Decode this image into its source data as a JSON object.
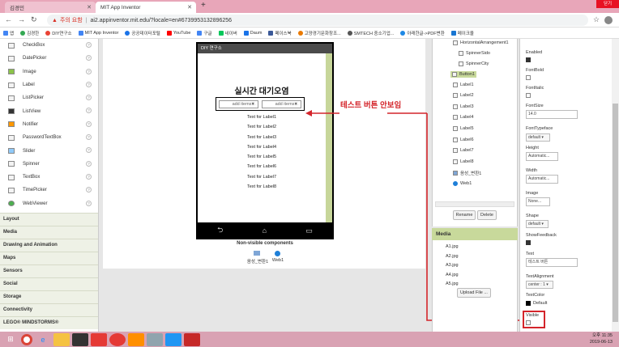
{
  "browser": {
    "tabs": [
      {
        "label": "김경민",
        "active": false
      },
      {
        "label": "MIT App Inventor",
        "active": true
      }
    ],
    "new_tab_label": "+",
    "window_close_label": "닫기",
    "address": {
      "warning": "주의 요함",
      "url": "ai2.appinventor.mit.edu/?locale=en#6739953132896256"
    },
    "bookmarks": [
      "앱",
      "김경한",
      "DIY연구소",
      "MIT App Inventor",
      "공공데이터포털",
      "YouTube",
      "구글",
      "네이버",
      "Daum",
      "페이스북",
      "고양경기문화창조...",
      "SMTECH 중소기업...",
      "아래한글->PDF변환",
      "메이크올"
    ]
  },
  "palette": {
    "items": [
      {
        "label": "CheckBox",
        "icon": "checkbox-icon"
      },
      {
        "label": "DatePicker",
        "icon": "datepicker-icon"
      },
      {
        "label": "Image",
        "icon": "image-icon"
      },
      {
        "label": "Label",
        "icon": "label-icon"
      },
      {
        "label": "ListPicker",
        "icon": "listpicker-icon"
      },
      {
        "label": "ListView",
        "icon": "listview-icon"
      },
      {
        "label": "Notifier",
        "icon": "notifier-icon"
      },
      {
        "label": "PasswordTextBox",
        "icon": "password-icon"
      },
      {
        "label": "Slider",
        "icon": "slider-icon"
      },
      {
        "label": "Spinner",
        "icon": "spinner-icon"
      },
      {
        "label": "TextBox",
        "icon": "textbox-icon"
      },
      {
        "label": "TimePicker",
        "icon": "timepicker-icon"
      },
      {
        "label": "WebViewer",
        "icon": "webviewer-icon"
      }
    ],
    "help_glyph": "?",
    "categories": [
      "Layout",
      "Media",
      "Drawing and Animation",
      "Maps",
      "Sensors",
      "Social",
      "Storage",
      "Connectivity",
      "LEGO® MINDSTORMS®"
    ]
  },
  "viewer": {
    "screen_title": "DIY 연구소",
    "heading": "실시간 대기오염",
    "spinner1": "add items...",
    "spinner2": "add items...",
    "labels": [
      "Text for Label1",
      "Text for Label2",
      "Text for Label3",
      "Text for Label4",
      "Text for Label5",
      "Text for Label6",
      "Text for Label7",
      "Text for Label8"
    ],
    "nav_back": "⮌",
    "nav_home": "⌂",
    "nav_recent": "▭",
    "nonvisible_title": "Non-visible components",
    "nonvisible_items": [
      "음성_변환1",
      "Web1"
    ],
    "annotation": "테스트 버튼 안보임"
  },
  "components": {
    "items": [
      {
        "label": "HorizontalArrangement1",
        "icon": "arrangement-icon"
      },
      {
        "label": "SpinnerSido",
        "icon": "spinner-icon"
      },
      {
        "label": "SpinnerCity",
        "icon": "spinner-icon"
      },
      {
        "label": "Button1",
        "icon": "button-icon"
      },
      {
        "label": "Label1",
        "icon": "label-icon"
      },
      {
        "label": "Label2",
        "icon": "label-icon"
      },
      {
        "label": "Label3",
        "icon": "label-icon"
      },
      {
        "label": "Label4",
        "icon": "label-icon"
      },
      {
        "label": "Label5",
        "icon": "label-icon"
      },
      {
        "label": "Label6",
        "icon": "label-icon"
      },
      {
        "label": "Label7",
        "icon": "label-icon"
      },
      {
        "label": "Label8",
        "icon": "label-icon"
      },
      {
        "label": "음성_변환1",
        "icon": "tts-icon"
      },
      {
        "label": "Web1",
        "icon": "web-icon"
      }
    ],
    "rename_label": "Rename",
    "delete_label": "Delete"
  },
  "media": {
    "title": "Media",
    "files": [
      "A1.jpg",
      "A2.jpg",
      "A3.jpg",
      "A4.jpg",
      "A5.jpg"
    ],
    "upload_label": "Upload File ..."
  },
  "properties": {
    "enabled_label": "Enabled",
    "fontbold_label": "FontBold",
    "fontitalic_label": "FontItalic",
    "fontsize_label": "FontSize",
    "fontsize_value": "14.0",
    "fonttypeface_label": "FontTypeface",
    "fonttypeface_value": "default",
    "height_label": "Height",
    "height_value": "Automatic...",
    "width_label": "Width",
    "width_value": "Automatic...",
    "image_label": "Image",
    "image_value": "None...",
    "shape_label": "Shape",
    "shape_value": "default",
    "showfeedback_label": "ShowFeedback",
    "text_label": "Text",
    "text_value": "테스트 버튼",
    "textalignment_label": "TextAlignment",
    "textalignment_value": "center : 1",
    "textcolor_label": "TextColor",
    "textcolor_value": "Default",
    "visible_label": "Visible"
  },
  "taskbar": {
    "time": "오후 11:35",
    "date": "2019-06-13"
  },
  "colors": {
    "annotation": "#d4252b",
    "accent": "#c8d99b",
    "tabbar": "#e8a6b9"
  }
}
